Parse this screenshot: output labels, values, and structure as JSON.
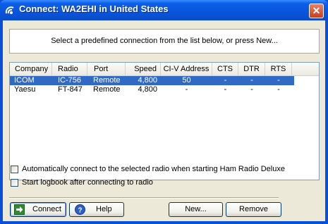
{
  "window": {
    "title": "Connect: WA2EHI in United States",
    "close_glyph": "✕"
  },
  "prompt": "Select a predefined connection from the list below, or press New...",
  "columns": [
    "Company",
    "Radio",
    "Port",
    "Speed",
    "CI-V Address",
    "CTS",
    "DTR",
    "RTS"
  ],
  "rows": [
    {
      "company": "ICOM",
      "radio": "IC-756",
      "port": "Remote",
      "speed": "4,800",
      "civ": "50",
      "cts": "-",
      "dtr": "-",
      "rts": "-",
      "selected": true
    },
    {
      "company": "Yaesu",
      "radio": "FT-847",
      "port": "Remote",
      "speed": "4,800",
      "civ": "-",
      "cts": "-",
      "dtr": "-",
      "rts": "-",
      "selected": false
    }
  ],
  "options": {
    "auto_connect": {
      "label": "Automatically connect to the selected radio when starting Ham Radio Deluxe",
      "checked": false
    },
    "start_logbook": {
      "label": "Start logbook after connecting to radio",
      "checked": false
    }
  },
  "buttons": {
    "connect": "Connect",
    "help": "Help",
    "new": "New...",
    "remove": "Remove"
  },
  "colors": {
    "title_bar": "#0a55dc",
    "selection": "#316ac5",
    "dialog_bg": "#ece9d8",
    "close_button": "#c5401f"
  },
  "icons": {
    "app": "ham-radio-icon",
    "connect": "green-arrow-icon",
    "help": "help-icon"
  }
}
